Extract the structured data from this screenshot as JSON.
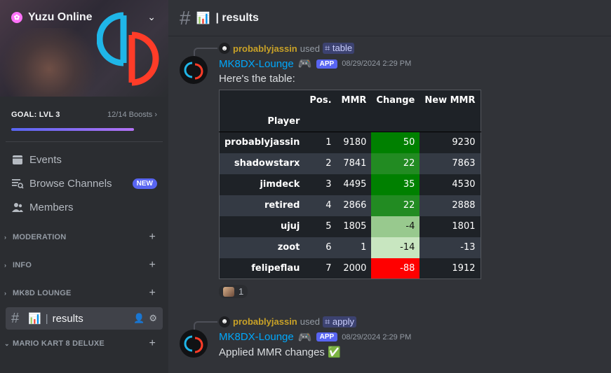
{
  "server": {
    "name": "Yuzu Online",
    "goal_title": "GOAL: LVL 3",
    "goal_boosts": "12/14 Boosts",
    "goal_progress": 0.857
  },
  "nav": [
    {
      "label": "Events",
      "icon": "calendar-icon"
    },
    {
      "label": "Browse Channels",
      "icon": "browse-channels-icon",
      "badge": "NEW"
    },
    {
      "label": "Members",
      "icon": "members-icon"
    }
  ],
  "categories": {
    "moderation": "MODERATION",
    "info": "INFO",
    "mk8d_lounge": "MK8D LOUNGE",
    "mario_kart": "MARIO KART 8 DELUXE"
  },
  "active_channel": {
    "emoji": "📊",
    "name": "results"
  },
  "topbar": {
    "emoji": "📊",
    "title": "| results"
  },
  "messages": [
    {
      "reply_user": "probablyjassin",
      "reply_used": "used",
      "reply_command": "table",
      "bot_name": "MK8DX-Lounge",
      "app_tag": "APP",
      "timestamp": "08/29/2024 2:29 PM",
      "text": "Here's the table:",
      "reaction_count": "1"
    },
    {
      "reply_user": "probablyjassin",
      "reply_used": "used",
      "reply_command": "apply",
      "bot_name": "MK8DX-Lounge",
      "app_tag": "APP",
      "timestamp": "08/29/2024 2:29 PM",
      "text": "Applied MMR changes ✅"
    }
  ],
  "table": {
    "headers": [
      "Pos.",
      "MMR",
      "Change",
      "New MMR"
    ],
    "index_header": "Player",
    "rows": [
      {
        "player": "probablyjassin",
        "pos": "1",
        "mmr": "9180",
        "change": "50",
        "new_mmr": "9230",
        "change_color": "#008000"
      },
      {
        "player": "shadowstarx",
        "pos": "2",
        "mmr": "7841",
        "change": "22",
        "new_mmr": "7863",
        "change_color": "#228b22"
      },
      {
        "player": "jimdeck",
        "pos": "3",
        "mmr": "4495",
        "change": "35",
        "new_mmr": "4530",
        "change_color": "#008000"
      },
      {
        "player": "retired",
        "pos": "4",
        "mmr": "2866",
        "change": "22",
        "new_mmr": "2888",
        "change_color": "#228b22"
      },
      {
        "player": "ujuj",
        "pos": "5",
        "mmr": "1805",
        "change": "-4",
        "new_mmr": "1801",
        "change_color": "#98c98e"
      },
      {
        "player": "zoot",
        "pos": "6",
        "mmr": "1",
        "change": "-14",
        "new_mmr": "-13",
        "change_color": "#c8e6c0"
      },
      {
        "player": "felipeflau",
        "pos": "7",
        "mmr": "2000",
        "change": "-88",
        "new_mmr": "1912",
        "change_color": "#ff0000"
      }
    ]
  }
}
